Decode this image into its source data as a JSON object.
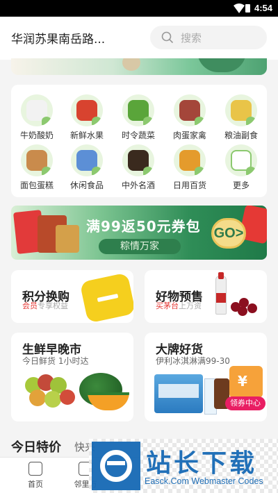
{
  "status_bar": {
    "time": "4:54"
  },
  "header": {
    "location": "华润苏果南岳路...",
    "search_placeholder": "搜索"
  },
  "categories": [
    {
      "label": "牛奶酸奶",
      "color": "#f2f2f2"
    },
    {
      "label": "新鲜水果",
      "color": "#d8432f"
    },
    {
      "label": "时令蔬菜",
      "color": "#5aa53a"
    },
    {
      "label": "肉蛋家禽",
      "color": "#a4463a"
    },
    {
      "label": "粮油副食",
      "color": "#e9c448"
    },
    {
      "label": "面包蛋糕",
      "color": "#c98b4c"
    },
    {
      "label": "休闲食品",
      "color": "#5c8fd6"
    },
    {
      "label": "中外名酒",
      "color": "#3a2a1e"
    },
    {
      "label": "日用百货",
      "color": "#e49b2c"
    },
    {
      "label": "更多",
      "color": "#ffffff"
    }
  ],
  "promo_banner": {
    "title": "满99返50元券包",
    "subtitle": "粽情万家",
    "go_label": "GO>"
  },
  "points_card": {
    "title": "积分换购",
    "tag": "会员",
    "desc": "专享权益"
  },
  "presale_card": {
    "title": "好物预售",
    "tag": "买茅台",
    "desc": "上万资"
  },
  "fresh_card": {
    "title": "生鲜早晚市",
    "desc": "今日鲜货 1小时达"
  },
  "brand_card": {
    "title": "大牌好货",
    "desc": "伊利冰淇淋满99-30",
    "badge": "领券中心",
    "coupon_symbol": "¥"
  },
  "today_section": {
    "title": "今日特价",
    "subtitle": "快来"
  },
  "tab_bar": [
    {
      "label": "首页"
    },
    {
      "label": "邻里万"
    }
  ],
  "watermark": {
    "title": "站长下载",
    "url_text": "Easck.Com Webmaster Codes"
  },
  "colors": {
    "brand_green": "#2f8d57",
    "accent_red": "#e53935",
    "watermark_blue": "#1669b5"
  }
}
